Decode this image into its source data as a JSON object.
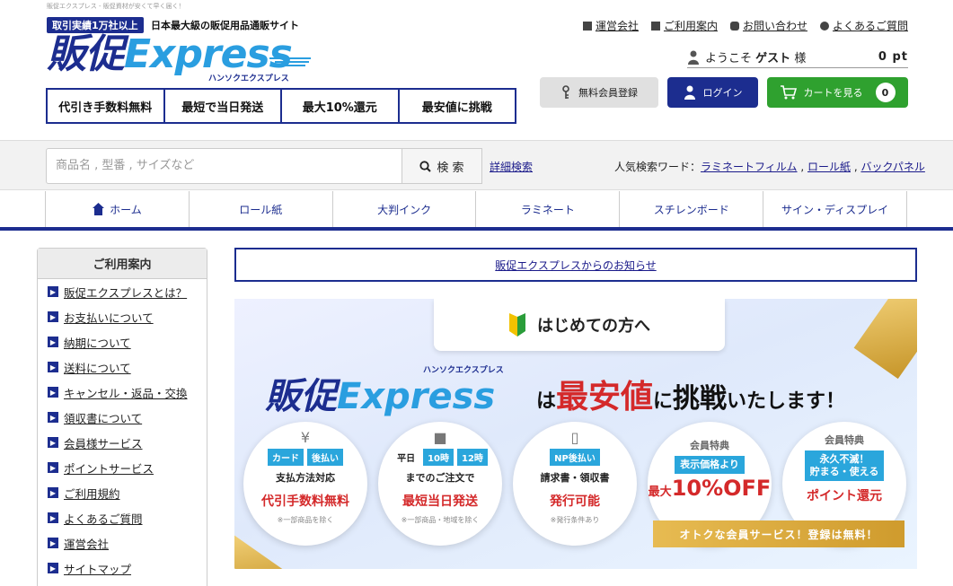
{
  "header": {
    "tagline": "販促エクスプレス - 販促資材が安くて早く届く！",
    "badge": "取引実績1万社以上",
    "subtitle": "日本最大級の販促用品通販サイト",
    "logo_kanji": "販促",
    "logo_express": "Express",
    "logo_kana": "ハンソクエクスプレス",
    "features": [
      "代引き手数料無料",
      "最短で当日発送",
      "最大10%還元",
      "最安値に挑戦"
    ],
    "top_links": [
      {
        "label": "運営会社",
        "icon": "building-icon"
      },
      {
        "label": "ご利用案内",
        "icon": "book-icon"
      },
      {
        "label": "お問い合わせ",
        "icon": "phone-icon"
      },
      {
        "label": "よくあるご質問",
        "icon": "chat-icon"
      }
    ],
    "welcome": "ようこそ",
    "guest": "ゲスト",
    "sama": "様",
    "points": "0 pt",
    "register_label": "無料会員登録",
    "login_label": "ログイン",
    "cart_label": "カートを見る",
    "cart_count": "0"
  },
  "search": {
    "placeholder": "商品名 , 型番 , サイズなど",
    "button_label": "検 索",
    "advanced_label": "詳細検索",
    "popular_label": "人気検索ワード：",
    "popular_words": [
      "ラミネートフィルム",
      "ロール紙",
      "バックパネル"
    ]
  },
  "nav": [
    "ホーム",
    "ロール紙",
    "大判インク",
    "ラミネート",
    "スチレンボード",
    "サイン・ディスプレイ"
  ],
  "sidebar": {
    "title": "ご利用案内",
    "items": [
      "販促エクスプレスとは？",
      "お支払いについて",
      "納期について",
      "送料について",
      "キャンセル・返品・交換",
      "領収書について",
      "会員様サービス",
      "ポイントサービス",
      "ご利用規約",
      "よくあるご質問",
      "運営会社",
      "サイトマップ"
    ]
  },
  "notice": "販促エクスプレスからのお知らせ",
  "banner": {
    "first_time": "はじめての方へ",
    "kana": "ハンソクエクスプレス",
    "tag_ha": "は",
    "tag_red": "最安値",
    "tag_ni": "に",
    "tag_challenge": "挑戦",
    "tag_end": "いたします！",
    "circles": [
      {
        "pills": [
          "カード",
          "後払い"
        ],
        "line2": "支払方法対応",
        "big": "代引手数料無料",
        "note": "※一部商品を除く"
      },
      {
        "pills": [
          "平日",
          "10時",
          "12時"
        ],
        "line2": "までのご注文で",
        "big": "最短当日発送",
        "note": "※一部商品・地域を除く"
      },
      {
        "pills": [
          "NP後払い"
        ],
        "line2": "請求書・領収書",
        "big": "発行可能",
        "note": "※発行条件あり"
      },
      {
        "mem": "会員特典",
        "box": "表示価格より",
        "off_prefix": "最大",
        "off": "10%OFF"
      },
      {
        "mem": "会員特典",
        "box1": "永久不滅！",
        "box2": "貯まる・使える",
        "pt": "ポイント還元"
      }
    ],
    "cta": "オトクな会員サービス！登録は無料！"
  }
}
